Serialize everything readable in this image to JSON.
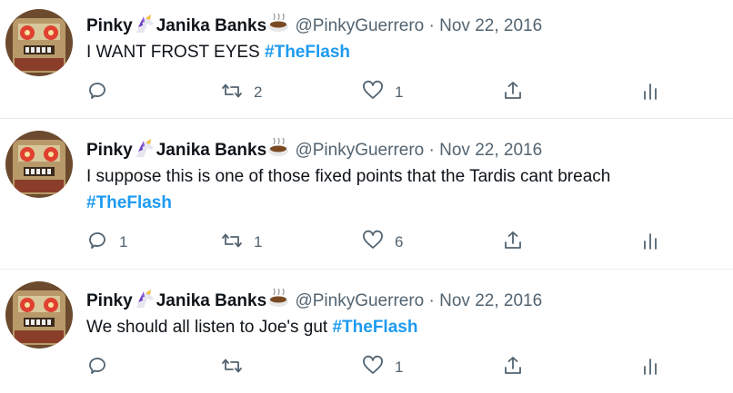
{
  "tweets": [
    {
      "name_first": "Pinky",
      "name_rest": "Janika Banks",
      "handle": "@PinkyGuerrero",
      "dot": "·",
      "date": "Nov 22, 2016",
      "text": "I WANT FROST EYES ",
      "hashtag": "#TheFlash",
      "reply_count": "",
      "retweet_count": "2",
      "like_count": "1"
    },
    {
      "name_first": "Pinky",
      "name_rest": "Janika Banks",
      "handle": "@PinkyGuerrero",
      "dot": "·",
      "date": "Nov 22, 2016",
      "text": "I suppose this is one of those fixed points that the Tardis cant breach",
      "hashtag": "#TheFlash",
      "reply_count": "1",
      "retweet_count": "1",
      "like_count": "6"
    },
    {
      "name_first": "Pinky",
      "name_rest": "Janika Banks",
      "handle": "@PinkyGuerrero",
      "dot": "·",
      "date": "Nov 22, 2016",
      "text": "We should all listen to Joe's gut ",
      "hashtag": "#TheFlash",
      "reply_count": "",
      "retweet_count": "",
      "like_count": "1"
    }
  ],
  "icons": {
    "reply": "reply-icon",
    "retweet": "retweet-icon",
    "like": "like-icon",
    "share": "share-icon",
    "analytics": "analytics-icon",
    "unicorn": "unicorn-emoji",
    "coffee": "hot-beverage-emoji"
  },
  "colors": {
    "hashtag": "#1d9bf0",
    "muted": "#536471",
    "divider": "#e6ecf0"
  }
}
